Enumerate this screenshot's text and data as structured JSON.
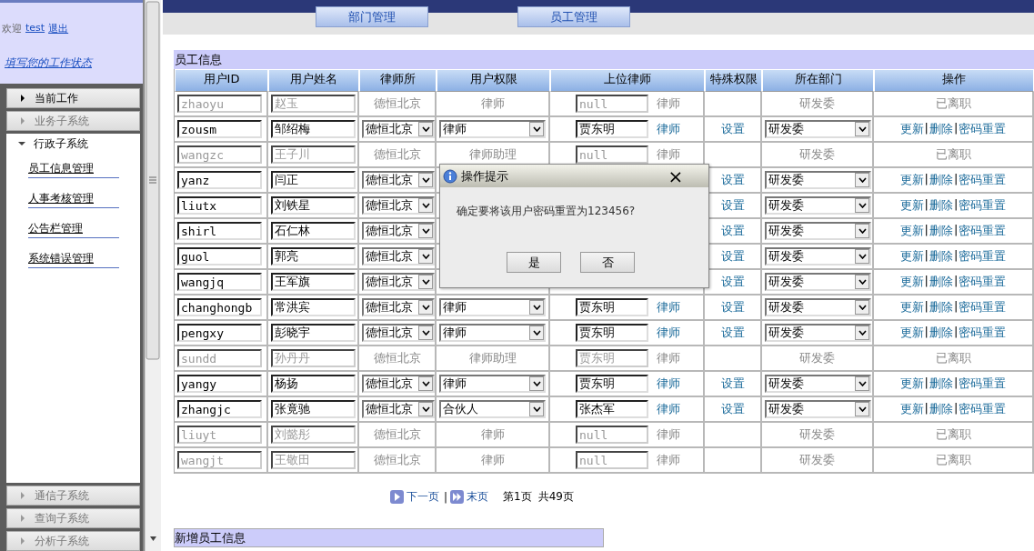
{
  "sidebar": {
    "welcome": "欢迎",
    "user": "test",
    "logout": "退出",
    "status_link": "填写您的工作状态",
    "sections": [
      {
        "label": "当前工作",
        "highlighted": true,
        "expanded": false
      },
      {
        "label": "业务子系统",
        "highlighted": false,
        "expanded": false
      },
      {
        "label": "行政子系统",
        "highlighted": false,
        "expanded": true,
        "items": [
          "员工信息管理",
          "人事考核管理",
          "公告栏管理",
          "系统错误管理"
        ]
      },
      {
        "label": "通信子系统",
        "highlighted": false,
        "expanded": false
      },
      {
        "label": "查询子系统",
        "highlighted": false,
        "expanded": false
      },
      {
        "label": "分析子系统",
        "highlighted": false,
        "expanded": false
      }
    ]
  },
  "top_tabs": [
    "部门管理",
    "员工管理"
  ],
  "table": {
    "title": "员工信息",
    "columns": [
      "用户ID",
      "用户姓名",
      "律师所",
      "用户权限",
      "上位律师",
      "特殊权限",
      "所在部门",
      "操作"
    ],
    "action_separator": "|",
    "rows": [
      {
        "kind": "resigned",
        "id": "zhaoyu",
        "name": "赵玉",
        "firm": "德恒北京",
        "role": "律师",
        "supervisor": "null",
        "supervisor_type": "律师",
        "dept": "研发委",
        "status": "已离职"
      },
      {
        "kind": "active",
        "id": "zousm",
        "name": "邹绍梅",
        "firm": "德恒北京",
        "role": "律师",
        "supervisor": "贾东明",
        "supervisor_type": "律师",
        "special": "设置",
        "dept": "研发委",
        "actions": [
          "更新",
          "删除",
          "密码重置"
        ]
      },
      {
        "kind": "resigned",
        "id": "wangzc",
        "name": "王子川",
        "firm": "德恒北京",
        "role": "律师助理",
        "supervisor": "null",
        "supervisor_type": "律师",
        "dept": "研发委",
        "status": "已离职"
      },
      {
        "kind": "active",
        "id": "yanz",
        "name": "闫正",
        "firm": "德恒北京",
        "special": "设置",
        "dept": "研发委",
        "actions": [
          "更新",
          "删除",
          "密码重置"
        ]
      },
      {
        "kind": "active",
        "id": "liutx",
        "name": "刘铁星",
        "firm": "德恒北京",
        "special": "设置",
        "dept": "研发委",
        "actions": [
          "更新",
          "删除",
          "密码重置"
        ]
      },
      {
        "kind": "active",
        "id": "shirl",
        "name": "石仁林",
        "firm": "德恒北京",
        "special": "设置",
        "dept": "研发委",
        "actions": [
          "更新",
          "删除",
          "密码重置"
        ]
      },
      {
        "kind": "active",
        "id": "guol",
        "name": "郭亮",
        "firm": "德恒北京",
        "special": "设置",
        "dept": "研发委",
        "actions": [
          "更新",
          "删除",
          "密码重置"
        ]
      },
      {
        "kind": "active",
        "id": "wangjq",
        "name": "王军旗",
        "firm": "德恒北京",
        "special": "设置",
        "dept": "研发委",
        "actions": [
          "更新",
          "删除",
          "密码重置"
        ]
      },
      {
        "kind": "active",
        "id": "changhongb",
        "name": "常洪宾",
        "firm": "德恒北京",
        "role": "律师",
        "supervisor": "贾东明",
        "supervisor_type": "律师",
        "special": "设置",
        "dept": "研发委",
        "actions": [
          "更新",
          "删除",
          "密码重置"
        ]
      },
      {
        "kind": "active",
        "id": "pengxy",
        "name": "彭晓宇",
        "firm": "德恒北京",
        "role": "律师",
        "supervisor": "贾东明",
        "supervisor_type": "律师",
        "special": "设置",
        "dept": "研发委",
        "actions": [
          "更新",
          "删除",
          "密码重置"
        ]
      },
      {
        "kind": "resigned",
        "id": "sundd",
        "name": "孙丹丹",
        "firm": "德恒北京",
        "role": "律师助理",
        "supervisor": "贾东明",
        "supervisor_type": "律师",
        "dept": "研发委",
        "status": "已离职"
      },
      {
        "kind": "active",
        "id": "yangy",
        "name": "杨扬",
        "firm": "德恒北京",
        "role": "律师",
        "supervisor": "贾东明",
        "supervisor_type": "律师",
        "special": "设置",
        "dept": "研发委",
        "actions": [
          "更新",
          "删除",
          "密码重置"
        ]
      },
      {
        "kind": "active",
        "id": "zhangjc",
        "name": "张竟驰",
        "firm": "德恒北京",
        "role": "合伙人",
        "supervisor": "张杰军",
        "supervisor_type": "律师",
        "special": "设置",
        "dept": "研发委",
        "actions": [
          "更新",
          "删除",
          "密码重置"
        ]
      },
      {
        "kind": "resigned",
        "id": "liuyt",
        "name": "刘懿彤",
        "firm": "德恒北京",
        "role": "律师",
        "supervisor": "null",
        "supervisor_type": "律师",
        "dept": "研发委",
        "status": "已离职"
      },
      {
        "kind": "resigned",
        "id": "wangjt",
        "name": "王敬田",
        "firm": "德恒北京",
        "role": "律师",
        "supervisor": "null",
        "supervisor_type": "律师",
        "dept": "研发委",
        "status": "已离职"
      }
    ]
  },
  "pagination": {
    "next": "下一页",
    "separator": "|",
    "last": "末页",
    "page": "第1页",
    "total": "共49页"
  },
  "add_section": {
    "title": "新增员工信息"
  },
  "dialog": {
    "title": "操作提示",
    "close": "×",
    "message": "确定要将该用户密码重置为123456?",
    "buttons": [
      "是",
      "否"
    ]
  }
}
